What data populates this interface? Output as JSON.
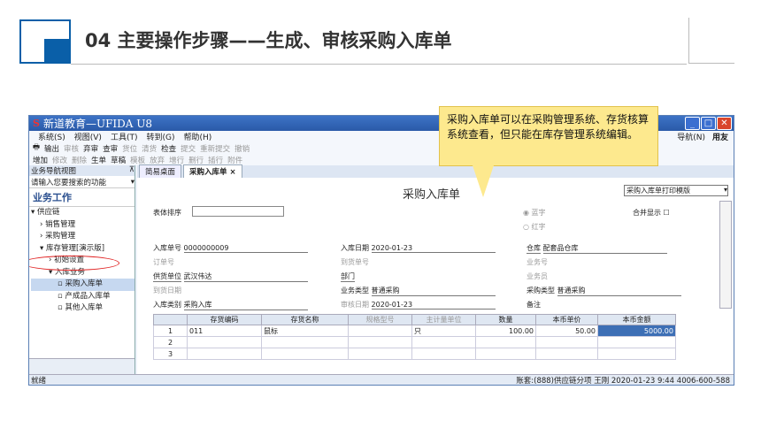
{
  "slide": {
    "title": "04  主要操作步骤——生成、审核采购入库单"
  },
  "callout": {
    "text": "采购入库单可以在采购管理系统、存货核算系统查看，但只能在库存管理系统编辑。"
  },
  "window": {
    "title": "新道教育—UFIDA U8",
    "logo": "S"
  },
  "menu": [
    "系统(S)",
    "视图(V)",
    "工具(T)",
    "转到(G)",
    "帮助(H)"
  ],
  "menu_right": {
    "nav": "导航(N)",
    "brand": "用友"
  },
  "toolbar1": [
    "输出",
    "审核",
    "弃审",
    "查审",
    "货位",
    "清货",
    "检查",
    "提交",
    "重新提交",
    "撤销"
  ],
  "toolbar2": [
    "增加",
    "修改",
    "删除",
    "生单",
    "草稿",
    "模板",
    "放弃",
    "增行",
    "删行",
    "插行",
    "附件"
  ],
  "sidebar": {
    "header": "业务导航视图",
    "search": "请输入您要搜索的功能",
    "section": "业务工作",
    "tree": [
      "供应链",
      "销售管理",
      "采购管理",
      "库存管理[演示版]",
      "初始设置",
      "入库业务",
      "采购入库单",
      "产成品入库单",
      "其他入库单"
    ]
  },
  "tabs": [
    "简易桌面",
    "采购入库单"
  ],
  "form": {
    "title": "采购入库单",
    "sort_label": "表体排序",
    "print_template": "采购入库单打印模版",
    "merge": "合并显示",
    "blue": "蓝字",
    "red": "红字",
    "fields": {
      "rk_no_l": "入库单号",
      "rk_no": "0000000009",
      "rk_date_l": "入库日期",
      "rk_date": "2020-01-23",
      "wh_l": "仓库",
      "wh": "配套品仓库",
      "order_l": "订单号",
      "arr_no_l": "到货单号",
      "biz_no_l": "业务号",
      "supplier_l": "供货单位",
      "supplier": "武汉伟达",
      "dept_l": "部门",
      "clerk_l": "业务员",
      "arr_date_l": "到货日期",
      "biztype_l": "业务类型",
      "biztype": "普通采购",
      "purtype_l": "采购类型",
      "purtype": "普通采购",
      "intype_l": "入库类别",
      "intype": "采购入库",
      "audit_l": "审核日期",
      "audit": "2020-01-23",
      "note_l": "备注"
    }
  },
  "grid": {
    "headers": [
      "",
      "存货编码",
      "存货名称",
      "规格型号",
      "主计量单位",
      "数量",
      "本币单价",
      "本币金额"
    ],
    "rows": [
      [
        "1",
        "011",
        "鼠标",
        "",
        "只",
        "100.00",
        "50.00",
        "5000.00"
      ],
      [
        "2",
        "",
        "",
        "",
        "",
        "",
        "",
        ""
      ],
      [
        "3",
        "",
        "",
        "",
        "",
        "",
        "",
        ""
      ]
    ]
  },
  "status": {
    "left": "就绪",
    "right": "账套:(888)供应链分项  王刚  2020-01-23 9:44  4006-600-588"
  }
}
